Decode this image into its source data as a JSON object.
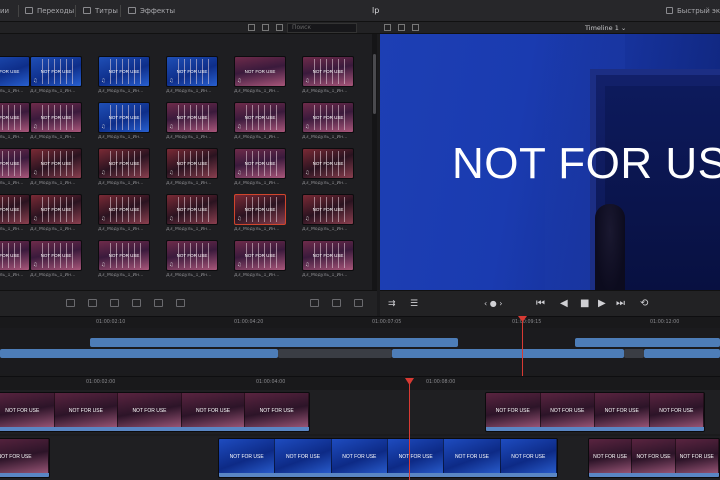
{
  "topbar": {
    "menu_left": "ии",
    "transitions": "Переходы",
    "titles": "Титры",
    "effects": "Эффекты",
    "project": "lp",
    "quick_export": "Быстрый экс"
  },
  "subbar": {
    "search_placeholder": "Поиск",
    "timeline_name": "Timeline 1 ⌄"
  },
  "pool": {
    "clip_label": "ДЗ_Модуль_1_Ин...",
    "overlay_text": "NOT FOR USE"
  },
  "viewer": {
    "overlay_text": "NOT FOR USE"
  },
  "transport": {
    "jog": "‹ ● ›",
    "to_start": "⏮",
    "prev": "◀",
    "stop": "■",
    "play": "▶",
    "to_end": "⏭",
    "loop": "⟲"
  },
  "ruler_upper": [
    "01:00:02:10",
    "01:00:04:20",
    "01:00:07:05",
    "01:00:09:15",
    "01:00:12:00"
  ],
  "ruler_lower": [
    "01:00:02:00",
    "01:00:04:00",
    "01:00:08:00"
  ],
  "timeline": {
    "clip_text": "NOT FOR USE"
  },
  "colors": {
    "accent_playhead": "#d83a33",
    "clip_blue": "#4d7db8",
    "selected_clip": "#d0452c"
  }
}
